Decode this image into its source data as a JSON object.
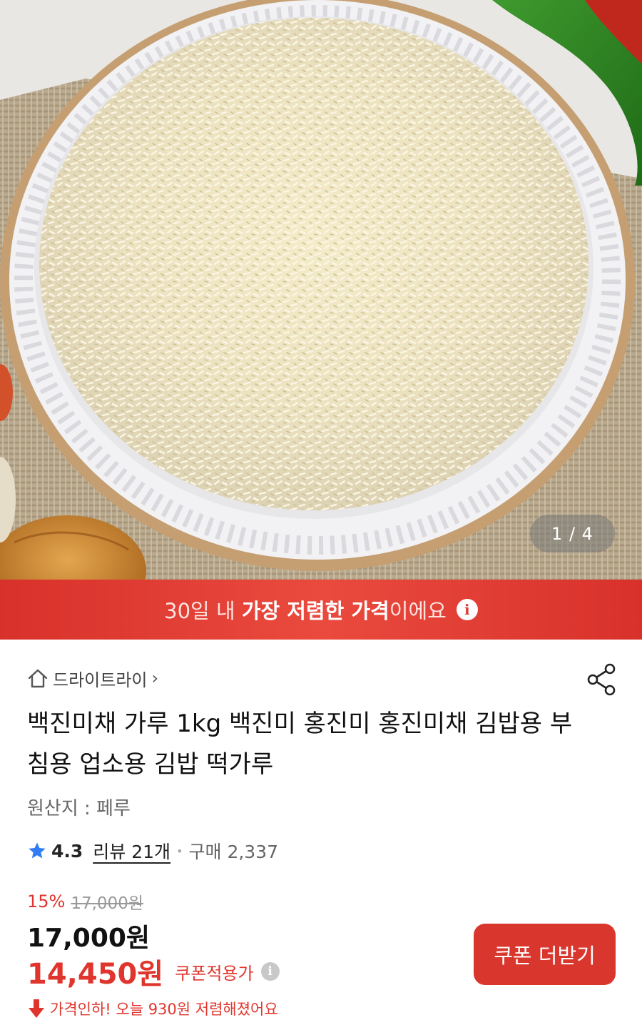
{
  "gallery": {
    "pager": "1 / 4"
  },
  "promo": {
    "prefix": "30일 내 ",
    "highlight": "가장 저렴한 가격",
    "suffix": "이에요",
    "info_icon": "info-icon"
  },
  "store": {
    "name": "드라이트라이",
    "home_icon": "home-icon",
    "chevron": "›"
  },
  "share": {
    "icon": "share-icon"
  },
  "product": {
    "title": "백진미채 가루 1kg 백진미 홍진미 홍진미채 김밥용 부침용 업소용 김밥 떡가루",
    "origin": "원산지 : 페루"
  },
  "rating": {
    "value": "4.3",
    "reviews": "리뷰 21개",
    "purchases": "구매 2,337"
  },
  "price": {
    "discount_rate": "15%",
    "original": "17,000원",
    "sale": "17,000원",
    "coupon_price": "14,450원",
    "coupon_label": "쿠폰적용가",
    "price_drop": "가격인하! 오늘 930원 저렴해졌어요"
  },
  "coupon_button": {
    "label": "쿠폰 더받기"
  },
  "colors": {
    "accent": "#e0352d",
    "banner": "#dd3a31",
    "star": "#2f7cf6"
  }
}
